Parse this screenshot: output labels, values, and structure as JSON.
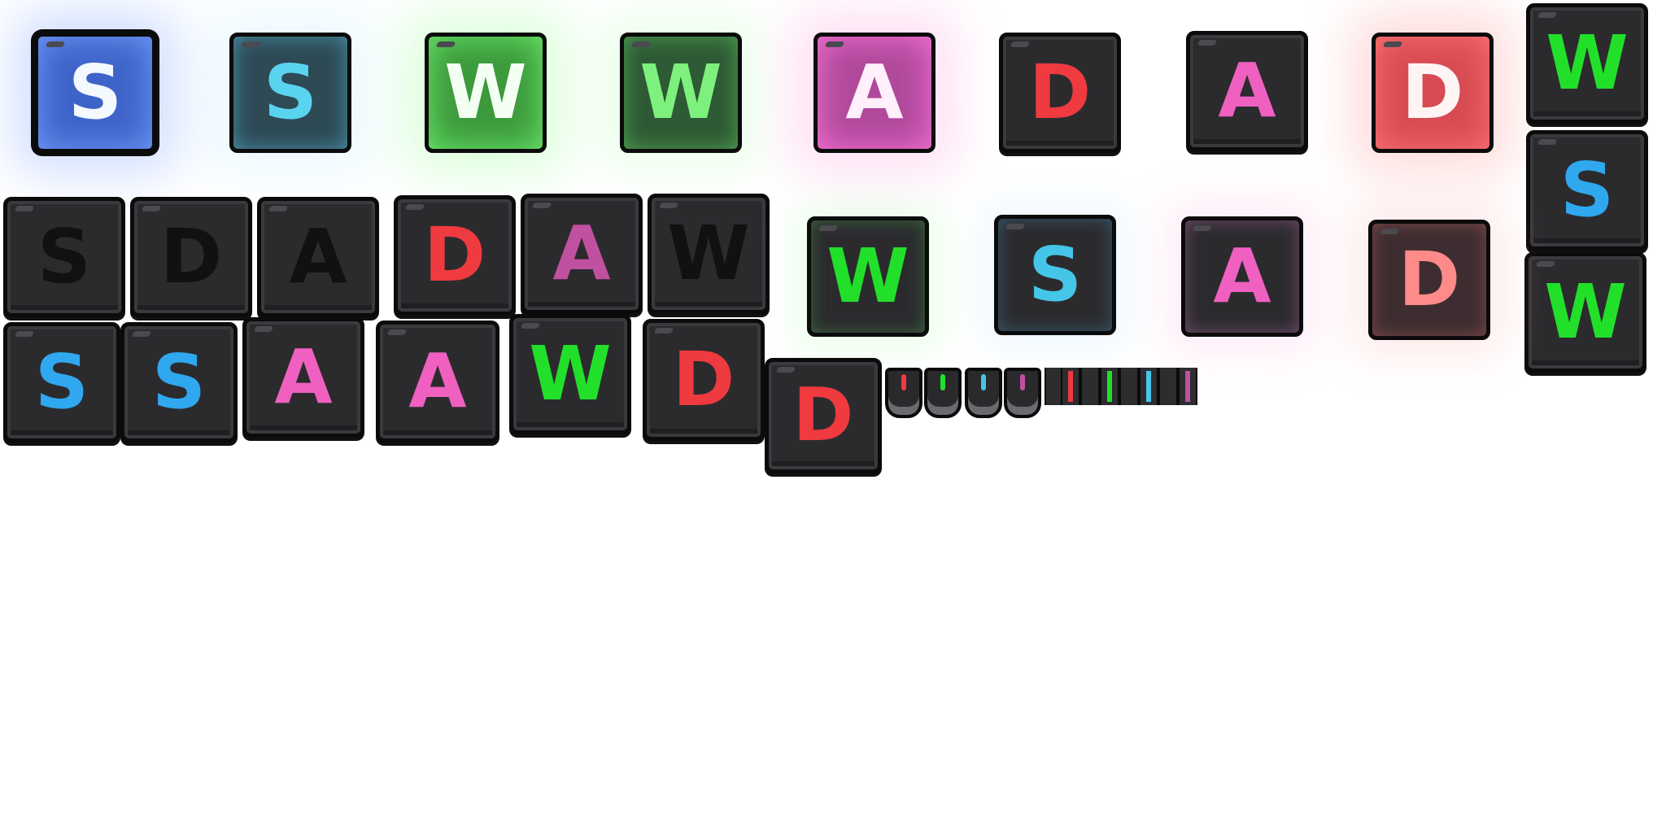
{
  "colors": {
    "blue": "#2fa8f0",
    "cyan": "#45c6e8",
    "green": "#22e02a",
    "pink": "#f060c0",
    "magenta": "#c050a0",
    "red": "#ef3a3f",
    "salmon": "#ff8a8a",
    "black": "#111111",
    "white": "#ffffff"
  },
  "row1": [
    "S",
    "S",
    "W",
    "W",
    "A",
    "D",
    "A",
    "D"
  ],
  "column_right": [
    "W",
    "S",
    "W"
  ],
  "row2_left": [
    "S",
    "D",
    "A",
    "D",
    "A",
    "W"
  ],
  "row2_right": [
    "W",
    "S",
    "A",
    "D"
  ],
  "row3": [
    "S",
    "S",
    "A",
    "A",
    "W",
    "D"
  ],
  "single_key": "D",
  "strip": {
    "small_keys": [
      "red",
      "green",
      "cyan",
      "magenta"
    ],
    "slices": [
      "red",
      "none",
      "green",
      "none",
      "cyan",
      "none",
      "magenta"
    ]
  }
}
